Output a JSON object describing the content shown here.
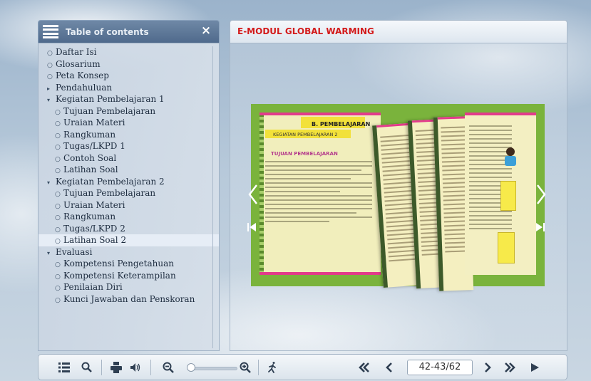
{
  "toc": {
    "title": "Table of contents",
    "close_label": "×",
    "items": [
      {
        "label": "Daftar Isi",
        "level": 0,
        "bullet": "○"
      },
      {
        "label": "Glosarium",
        "level": 0,
        "bullet": "○"
      },
      {
        "label": "Peta Konsep",
        "level": 0,
        "bullet": "○"
      },
      {
        "label": "Pendahuluan",
        "level": 0,
        "bullet": "▸"
      },
      {
        "label": "Kegiatan Pembelajaran 1",
        "level": 0,
        "bullet": "▾"
      },
      {
        "label": "Tujuan Pembelajaran",
        "level": 1,
        "bullet": "○"
      },
      {
        "label": "Uraian Materi",
        "level": 1,
        "bullet": "○"
      },
      {
        "label": "Rangkuman",
        "level": 1,
        "bullet": "○"
      },
      {
        "label": "Tugas/LKPD 1",
        "level": 1,
        "bullet": "○"
      },
      {
        "label": "Contoh Soal",
        "level": 1,
        "bullet": "○"
      },
      {
        "label": "Latihan Soal",
        "level": 1,
        "bullet": "○"
      },
      {
        "label": "Kegiatan Pembelajaran 2",
        "level": 0,
        "bullet": "▾"
      },
      {
        "label": "Tujuan Pembelajaran",
        "level": 1,
        "bullet": "○"
      },
      {
        "label": "Uraian Materi",
        "level": 1,
        "bullet": "○"
      },
      {
        "label": "Rangkuman",
        "level": 1,
        "bullet": "○"
      },
      {
        "label": "Tugas/LKPD 2",
        "level": 1,
        "bullet": "○"
      },
      {
        "label": "Latihan Soal 2",
        "level": 1,
        "bullet": "○",
        "active": true
      },
      {
        "label": "Evaluasi",
        "level": 0,
        "bullet": "▾"
      },
      {
        "label": "Kompetensi Pengetahuan",
        "level": 1,
        "bullet": "○"
      },
      {
        "label": "Kompetensi Keterampilan",
        "level": 1,
        "bullet": "○"
      },
      {
        "label": "Penilaian Diri",
        "level": 1,
        "bullet": "○"
      },
      {
        "label": "Kunci Jawaban dan Penskoran",
        "level": 1,
        "bullet": "○"
      }
    ]
  },
  "viewer": {
    "title": "E-MODUL GLOBAL WARMING",
    "page_heading": "B. PEMBELAJARAN",
    "page_subheading": "KEGIATAN PEMBELAJARAN 2",
    "section_heading": "TUJUAN PEMBELAJARAN"
  },
  "toolbar": {
    "page_indicator": "42-43/62",
    "icons": [
      "toc-icon",
      "search-icon",
      "print-icon",
      "sound-icon",
      "zoom-out-icon",
      "zoom-in-icon",
      "autoflip-icon",
      "first-page-icon",
      "prev-page-icon",
      "next-page-icon",
      "last-page-icon",
      "play-icon"
    ],
    "zoom_level": 0
  },
  "colors": {
    "title_red": "#d31a1a",
    "book_green": "#7ab33c",
    "accent_pink": "#e23b8b",
    "highlight_yellow": "#f2e13a"
  }
}
